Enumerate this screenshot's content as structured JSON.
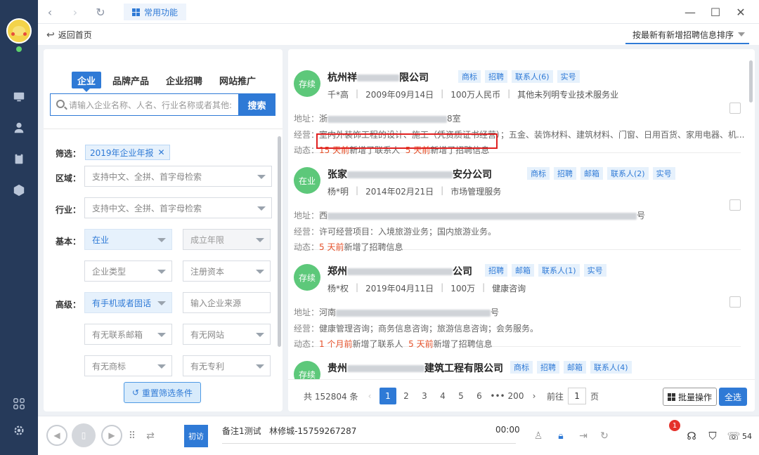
{
  "topbar": {
    "tab_label": "常用功能"
  },
  "subbar": {
    "back_label": "返回首页",
    "sort_label": "按最新有新增招聘信息排序"
  },
  "search": {
    "tabs": [
      "企业",
      "品牌产品",
      "企业招聘",
      "网站推广"
    ],
    "placeholder": "请输入企业名称、人名、行业名称或者其他:",
    "button": "搜索"
  },
  "filters": {
    "filter_label": "筛选：",
    "chip": "2019年企业年报",
    "region_label": "区域：",
    "region_placeholder": "支持中文、全拼、首字母检索",
    "industry_label": "行业：",
    "industry_placeholder": "支持中文、全拼、首字母检索",
    "basic_label": "基本：",
    "status_value": "在业",
    "founded_placeholder": "成立年限",
    "type_placeholder": "企业类型",
    "capital_placeholder": "注册资本",
    "advanced_label": "高级：",
    "phone_value": "有手机或者固话",
    "source_placeholder": "输入企业来源",
    "email_placeholder": "有无联系邮箱",
    "website_placeholder": "有无网站",
    "trademark_placeholder": "有无商标",
    "patent_placeholder": "有无专利",
    "reset_label": "重置筛选条件"
  },
  "results": [
    {
      "status": "存续",
      "name_a": "杭州祥",
      "name_b": "限公司",
      "tags": [
        "商标",
        "招聘",
        "联系人(6)",
        "实号"
      ],
      "person": "千*高",
      "date": "2009年09月14日",
      "capital": "100万人民币",
      "industry": "其他未列明专业技术服务业",
      "addr_label": "地址：",
      "addr_a": "浙",
      "addr_b": "8室",
      "biz_label": "经营：",
      "biz": "室内外装饰工程的设计、施工（凭资质证书经营）；五金、装饰材料、建筑材料、门窗、日用百货、家用电器、机...",
      "dyn_label": "动态：",
      "dyn1_time": "15 天前",
      "dyn1_text": "新增了联系人",
      "dyn2_time": "5 天前",
      "dyn2_text": "新增了招聘信息"
    },
    {
      "status": "在业",
      "name_a": "张家",
      "name_b": "安分公司",
      "tags": [
        "商标",
        "招聘",
        "邮箱",
        "联系人(2)",
        "实号"
      ],
      "person": "杨*明",
      "date": "2014年02月21日",
      "industry": "市场管理服务",
      "addr_label": "地址：",
      "addr_a": "西",
      "addr_b": "号",
      "biz_label": "经营：",
      "biz": "许可经营项目：入境旅游业务；国内旅游业务。",
      "dyn_label": "动态：",
      "dyn1_time": "5 天前",
      "dyn1_text": "新增了招聘信息"
    },
    {
      "status": "存续",
      "name_a": "郑州",
      "name_b": "公司",
      "tags": [
        "招聘",
        "邮箱",
        "联系人(1)",
        "实号"
      ],
      "person": "杨*权",
      "date": "2019年04月11日",
      "capital": "100万",
      "industry": "健康咨询",
      "addr_label": "地址：",
      "addr_a": "河南",
      "addr_b": "号",
      "biz_label": "经营：",
      "biz": "健康管理咨询；商务信息咨询；旅游信息咨询；会务服务。",
      "dyn_label": "动态：",
      "dyn1_time": "1 个月前",
      "dyn1_text": "新增了联系人",
      "dyn2_time": "5 天前",
      "dyn2_text": "新增了招聘信息"
    },
    {
      "status": "存续",
      "name_a": "贵州",
      "name_b": "建筑工程有限公司",
      "tags": [
        "商标",
        "招聘",
        "邮箱",
        "联系人(4)"
      ]
    }
  ],
  "pagination": {
    "total": "共 152804 条",
    "pages": [
      "1",
      "2",
      "3",
      "4",
      "5",
      "6",
      "•••",
      "200"
    ],
    "goto_label": "前往",
    "goto_value": "1",
    "page_unit": "页",
    "batch_label": "批量操作",
    "select_all_label": "全选"
  },
  "callbar": {
    "visit_label": "初访",
    "note": "备注1测试",
    "contact": "林修城-15759267287",
    "time": "00:00",
    "notif_count": "1",
    "count": "54"
  }
}
